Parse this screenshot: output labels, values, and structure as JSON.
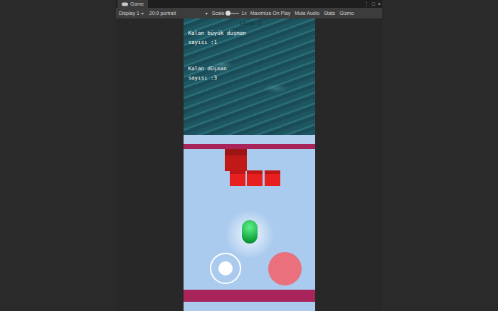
{
  "window": {
    "title": "Game",
    "buttons": [
      "⋮",
      "□",
      "×"
    ]
  },
  "toolbar": [
    {
      "label": "Display 1",
      "kind": "dropdown",
      "arrow": "▾"
    },
    {
      "label": "20:9 portrait",
      "kind": "dropdown",
      "arrow": "▾"
    },
    {
      "label": "Scale",
      "kind": "slider",
      "level": 0,
      "reading": "1x"
    },
    {
      "label": "Maximize On Play",
      "kind": "toggle",
      "on": false
    },
    {
      "label": "Mute Audio",
      "kind": "toggle",
      "on": false
    },
    {
      "label": "Stats",
      "kind": "toggle",
      "on": false
    },
    {
      "label": "Gizmo",
      "kind": "toggle",
      "on": false
    }
  ],
  "hud": {
    "level": "Level 1",
    "counters": [
      {
        "lines": [
          "Kalan büyük düşman",
          "sayısı :1"
        ]
      },
      {
        "lines": [
          "Kalan düşman",
          "sayısı :3"
        ]
      }
    ]
  },
  "enemies": [
    {
      "kind": "big"
    },
    {
      "kind": "small"
    },
    {
      "kind": "small"
    },
    {
      "kind": "small"
    }
  ]
}
